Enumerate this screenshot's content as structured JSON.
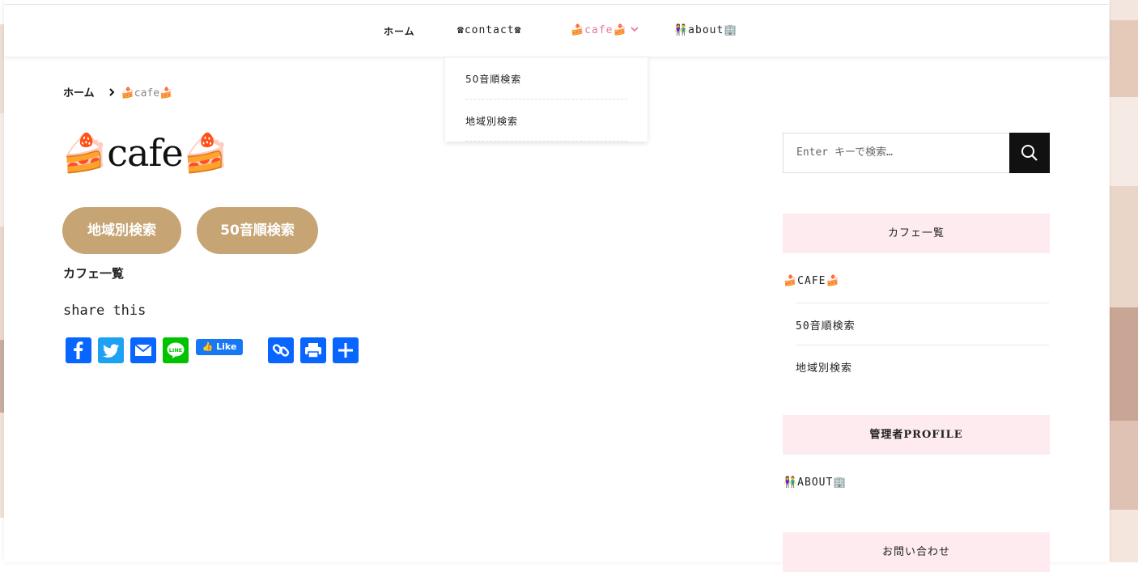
{
  "nav": {
    "items": [
      {
        "label": "ホーム"
      },
      {
        "label": "☎contact☎"
      },
      {
        "label": "🍰cafe🍰"
      },
      {
        "label": "👫about🏢"
      }
    ],
    "dropdown": [
      {
        "label": "50音順検索"
      },
      {
        "label": "地域別検索"
      }
    ]
  },
  "breadcrumb": {
    "home": "ホーム",
    "current": "🍰cafe🍰"
  },
  "page": {
    "title": "🍰cafe🍰",
    "buttons": [
      {
        "label": "地域別検索"
      },
      {
        "label": "50音順検索"
      }
    ],
    "list_link": "カフェ一覧",
    "share_label": "share this",
    "fb_like": "Like",
    "share_icons": [
      "facebook-icon",
      "twitter-icon",
      "email-icon",
      "line-icon",
      "copy-link-icon",
      "print-icon",
      "share-icon"
    ]
  },
  "sidebar": {
    "search_placeholder": "Enter キーで検索…",
    "widget1_title": "カフェ一覧",
    "category": "🍰CAFE🍰",
    "sub_items": [
      {
        "label": "50音順検索"
      },
      {
        "label": "地域別検索"
      }
    ],
    "widget2_title": "管理者PROFILE",
    "about_link": "👫ABOUT🏢",
    "widget3_title": "お問い合わせ"
  },
  "colors": {
    "accent_pink": "#e8799a",
    "button_tan": "#c6a473",
    "widget_bg": "#fdebf0",
    "share_blue": "#0866ff"
  }
}
